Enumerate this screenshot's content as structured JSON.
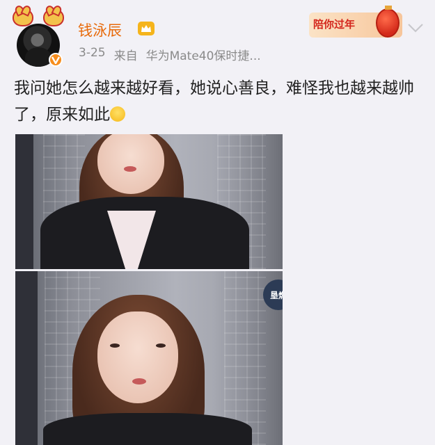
{
  "user": {
    "name": "钱泳辰",
    "avatar_icon": "avatar-photo",
    "verified_icon": "verified-v-icon",
    "member_icon": "member-crown-icon"
  },
  "meta": {
    "date": "3-25",
    "source_prefix": "来自",
    "device": "华为Mate40保时捷..."
  },
  "promo": {
    "text": "陪你过年",
    "icon": "lantern-icon"
  },
  "menu": {
    "icon": "chevron-down-icon"
  },
  "post": {
    "text": "我问她怎么越来越好看，她说心善良，难怪我也越来越帅了，原来如此",
    "emoji_icon": "laugh-cry-emoji"
  },
  "images": {
    "watermark_text": "垦燃"
  }
}
